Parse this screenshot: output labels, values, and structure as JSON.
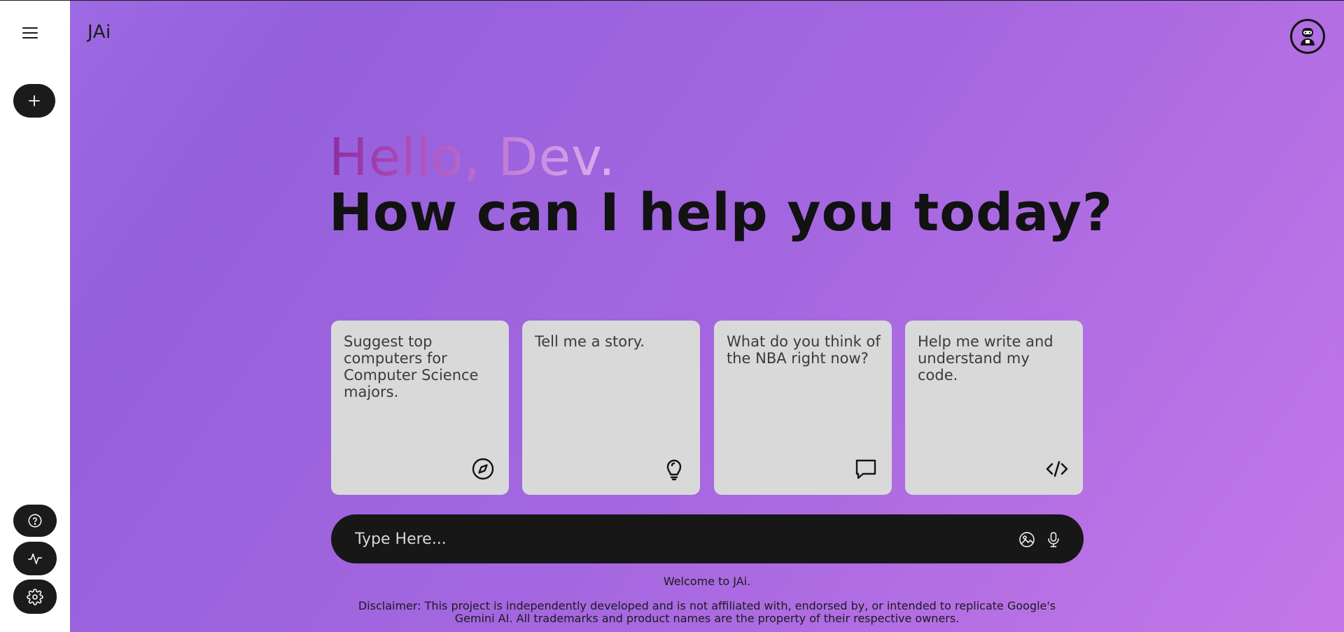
{
  "app": {
    "brand": "JAi"
  },
  "sidebar": {
    "menu_icon": "hamburger-icon",
    "new_chat_icon": "plus-icon",
    "help_icon": "help-circle-icon",
    "activity_icon": "activity-icon",
    "settings_icon": "gear-icon"
  },
  "header": {
    "avatar_icon": "robot-avatar-icon"
  },
  "greeting": {
    "line1": "Hello, Dev.",
    "line2": "How can I help you today?"
  },
  "cards": [
    {
      "text": "Suggest top computers for Computer Science majors.",
      "icon": "compass-icon"
    },
    {
      "text": "Tell me a story.",
      "icon": "lightbulb-icon"
    },
    {
      "text": "What do you think of the NBA right now?",
      "icon": "chat-bubble-icon"
    },
    {
      "text": "Help me write and understand my code.",
      "icon": "code-icon"
    }
  ],
  "prompt": {
    "placeholder": "Type Here...",
    "value": "",
    "image_icon": "image-upload-icon",
    "mic_icon": "microphone-icon"
  },
  "footer": {
    "welcome": "Welcome to JAi.",
    "disclaimer": "Disclaimer: This project is independently developed and is not affiliated with, endorsed by, or intended to replicate Google's Gemini AI. All trademarks and product names are the property of their respective owners."
  },
  "colors": {
    "background_start": "#9f6de4",
    "background_end": "#c477e8",
    "sidebar": "#ffffff",
    "pill": "#1b1b1b",
    "card": "#d9d9d9",
    "prompt_bar": "#171717",
    "greeting_accent": "#8e2c9e"
  }
}
